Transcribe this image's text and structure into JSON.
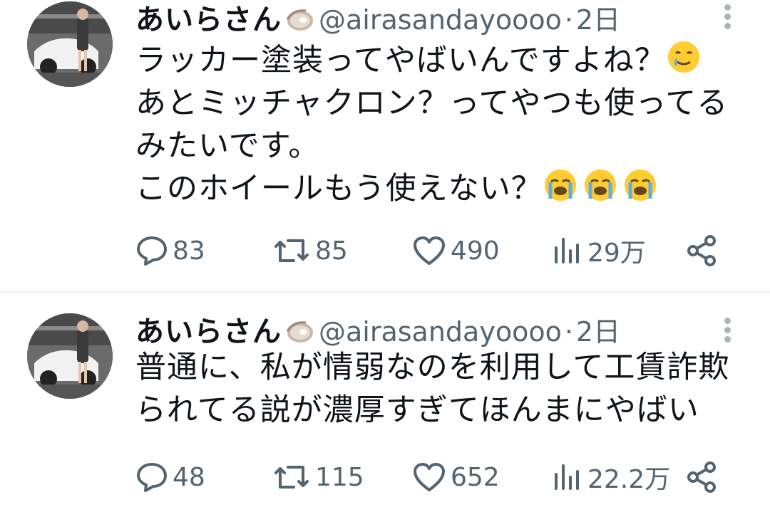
{
  "tweets": [
    {
      "display_name": "あいらさん",
      "handle": "@airasandayoooo",
      "separator": "·",
      "time": "2日",
      "lines": [
        "ラッカー塗装ってやばいんですよね？",
        "あとミッチャクロン？ってやつも使ってる",
        "みたいです。",
        "このホイールもう使えない？"
      ],
      "line1_emoji": "smiling-face-with-tear-icon",
      "line4_emoji": [
        "loudly-crying-face-icon",
        "loudly-crying-face-icon",
        "loudly-crying-face-icon"
      ],
      "stats": {
        "replies": "83",
        "retweets": "85",
        "likes": "490",
        "views": "29万"
      }
    },
    {
      "display_name": "あいらさん",
      "handle": "@airasandayoooo",
      "separator": "·",
      "time": "2日",
      "lines": [
        "普通に、私が情弱なのを利用して工賃詐欺",
        "られてる説が濃厚すぎてほんまにやばい"
      ],
      "stats": {
        "replies": "48",
        "retweets": "115",
        "likes": "652",
        "views": "22.2万"
      }
    }
  ],
  "colors": {
    "text": "#0f1419",
    "secondary": "#536471",
    "divider": "#eff3f4",
    "background": "#ffffff"
  },
  "icons": [
    "reply-icon",
    "retweet-icon",
    "like-icon",
    "views-icon",
    "share-icon",
    "more-icon",
    "oyster-icon"
  ]
}
